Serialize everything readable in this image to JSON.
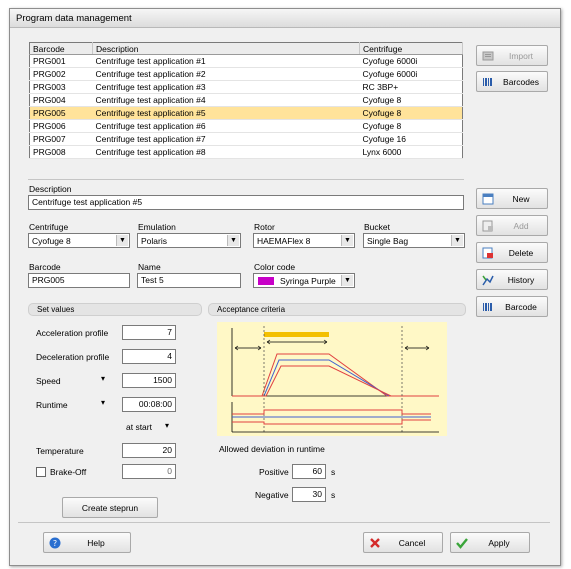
{
  "window": {
    "title": "Program data management"
  },
  "grid": {
    "headers": [
      "Barcode",
      "Description",
      "Centrifuge"
    ],
    "rows": [
      [
        "PRG001",
        "Centrifuge test application #1",
        "Cyofuge 6000i"
      ],
      [
        "PRG002",
        "Centrifuge test application #2",
        "Cyofuge 6000i"
      ],
      [
        "PRG003",
        "Centrifuge test application #3",
        "RC 3BP+"
      ],
      [
        "PRG004",
        "Centrifuge test application #4",
        "Cyofuge 8"
      ],
      [
        "PRG005",
        "Centrifuge test application #5",
        "Cyofuge 8"
      ],
      [
        "PRG006",
        "Centrifuge test application #6",
        "Cyofuge 8"
      ],
      [
        "PRG007",
        "Centrifuge test application #7",
        "Cyofuge 16"
      ],
      [
        "PRG008",
        "Centrifuge test application #8",
        "Lynx 6000"
      ]
    ],
    "selected_index": 4
  },
  "side_buttons": {
    "import": "Import",
    "barcodes": "Barcodes",
    "new": "New",
    "add": "Add",
    "delete": "Delete",
    "history": "History",
    "barcode": "Barcode"
  },
  "form": {
    "description_label": "Description",
    "description_value": "Centrifuge test application #5",
    "centrifuge_label": "Centrifuge",
    "centrifuge_value": "Cyofuge 8",
    "emulation_label": "Emulation",
    "emulation_value": "Polaris",
    "rotor_label": "Rotor",
    "rotor_value": "HAEMAFlex 8",
    "bucket_label": "Bucket",
    "bucket_value": "Single Bag",
    "barcode_label": "Barcode",
    "barcode_value": "PRG005",
    "name_label": "Name",
    "name_value": "Test 5",
    "color_label": "Color code",
    "color_value": "Syringa Purple",
    "color_swatch": "#c700c7"
  },
  "set_values": {
    "title": "Set values",
    "accel_label": "Acceleration profile",
    "accel_value": "7",
    "decel_label": "Deceleration profile",
    "decel_value": "4",
    "speed_label": "Speed",
    "speed_value": "1500",
    "runtime_label": "Runtime",
    "runtime_value": "00:08:00",
    "start_value": "at start",
    "temp_label": "Temperature",
    "temp_value": "20",
    "brake_label": "Brake-Off",
    "brake_value": "0",
    "create_steprun": "Create steprun"
  },
  "acceptance": {
    "title": "Acceptance criteria",
    "deviation_label": "Allowed deviation in runtime",
    "positive_label": "Positive",
    "positive_value": "60",
    "positive_unit": "s",
    "negative_label": "Negative",
    "negative_value": "30",
    "negative_unit": "s",
    "diagram_bg": "#fff8c6"
  },
  "footer": {
    "help": "Help",
    "cancel": "Cancel",
    "apply": "Apply"
  }
}
